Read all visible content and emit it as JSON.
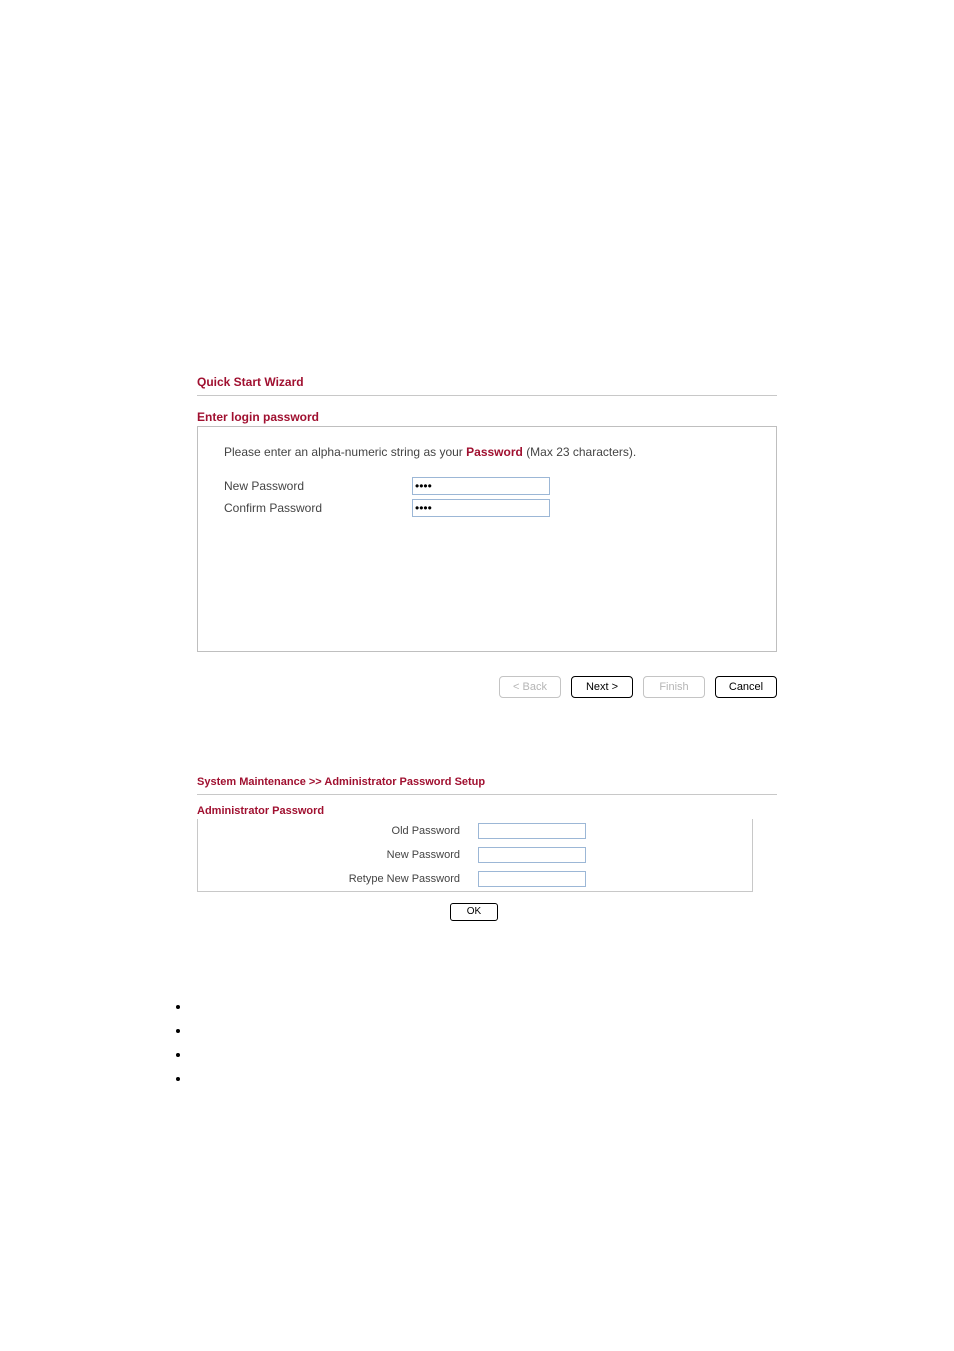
{
  "wizard": {
    "title": "Quick Start Wizard",
    "section": "Enter login password",
    "instruction_pre": "Please enter an alpha-numeric string as your ",
    "instruction_bold": "Password",
    "instruction_post": " (Max 23 characters).",
    "new_password_label": "New Password",
    "confirm_password_label": "Confirm Password",
    "new_password_value": "••••",
    "confirm_password_value": "••••",
    "buttons": {
      "back": "< Back",
      "next": "Next >",
      "finish": "Finish",
      "cancel": "Cancel"
    }
  },
  "admin": {
    "title": "System Maintenance >> Administrator Password Setup",
    "section": "Administrator Password",
    "old_password_label": "Old Password",
    "new_password_label": "New Password",
    "retype_password_label": "Retype New Password",
    "ok": "OK"
  }
}
